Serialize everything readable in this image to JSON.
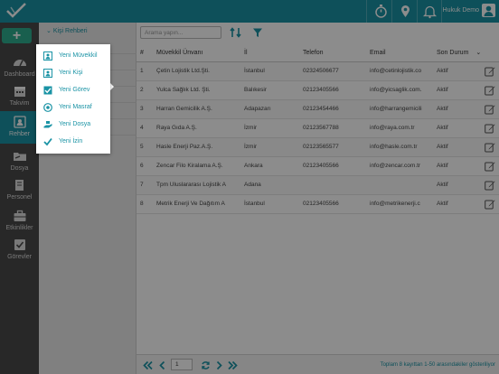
{
  "topbar": {
    "user_name": "Hukuk Demo",
    "icons": [
      "timer-icon",
      "location-icon",
      "bell-icon",
      "user-icon"
    ]
  },
  "sidebar": {
    "add_label": "+",
    "items": [
      {
        "label": "Dashboard",
        "icon": "dashboard-icon"
      },
      {
        "label": "Takvim",
        "icon": "calendar-icon"
      },
      {
        "label": "Rehber",
        "icon": "contacts-icon",
        "active": true
      },
      {
        "label": "Dosya",
        "icon": "folder-icon"
      },
      {
        "label": "Personel",
        "icon": "book-icon"
      },
      {
        "label": "Etkinlikler",
        "icon": "briefcase-icon"
      },
      {
        "label": "Görevler",
        "icon": "tasks-icon"
      }
    ]
  },
  "subpanel": {
    "title": "Kişi Rehberi"
  },
  "toolbar": {
    "search_placeholder": "Arama yapın..."
  },
  "table": {
    "headers": [
      "#",
      "Müvekkil Ünvanı",
      "İl",
      "Telefon",
      "Email",
      "Son Durum"
    ],
    "rows": [
      {
        "no": "1",
        "name": "Çetin Lojistik Ltd.Şti.",
        "city": "İstanbul",
        "phone": "02324506677",
        "email": "info@cetinlojistik.co",
        "status": "Aktif"
      },
      {
        "no": "2",
        "name": "Yulca Sağlık Ltd. Şti.",
        "city": "Balıkesir",
        "phone": "02123405566",
        "email": "info@yicsaglik.com.",
        "status": "Aktif"
      },
      {
        "no": "3",
        "name": "Harran Gemicilik A.Ş.",
        "city": "Adapazarı",
        "phone": "02123454466",
        "email": "info@harrangemicili",
        "status": "Aktif"
      },
      {
        "no": "4",
        "name": "Raya Gıda A.Ş.",
        "city": "İzmir",
        "phone": "02123567788",
        "email": "info@raya.com.tr",
        "status": "Aktif"
      },
      {
        "no": "5",
        "name": "Hasle Enerji Paz.A.Ş.",
        "city": "İzmir",
        "phone": "02123565577",
        "email": "info@hasle.com.tr",
        "status": "Aktif"
      },
      {
        "no": "6",
        "name": "Zencar Filo Kiralama A.Ş.",
        "city": "Ankara",
        "phone": "02123405566",
        "email": "info@zencar.com.tr",
        "status": "Aktif"
      },
      {
        "no": "7",
        "name": "Tpm Uluslararası Lojistik A",
        "city": "Adana",
        "phone": "",
        "email": "",
        "status": "Aktif"
      },
      {
        "no": "8",
        "name": "Metrik Enerji Ve Dağıtım A",
        "city": "İstanbul",
        "phone": "02123405566",
        "email": "info@metrikenerji.c",
        "status": "Aktif"
      }
    ]
  },
  "footer": {
    "page": "1",
    "summary": "Toplam 8 kayıttan 1-50 arasındakiler gösteriliyor"
  },
  "menu": {
    "items": [
      {
        "label": "Yeni Müvekkil",
        "icon": "client-icon"
      },
      {
        "label": "Yeni Kişi",
        "icon": "person-icon"
      },
      {
        "label": "Yeni Görev",
        "icon": "checkbox-icon"
      },
      {
        "label": "Yeni Masraf",
        "icon": "expense-icon"
      },
      {
        "label": "Yeni Dosya",
        "icon": "file-hand-icon"
      },
      {
        "label": "Yeni İzin",
        "icon": "check-icon"
      }
    ]
  },
  "colors": {
    "accent": "#1a93a5",
    "sidebar": "#4a4a4a",
    "add_button": "#2fae8e"
  }
}
